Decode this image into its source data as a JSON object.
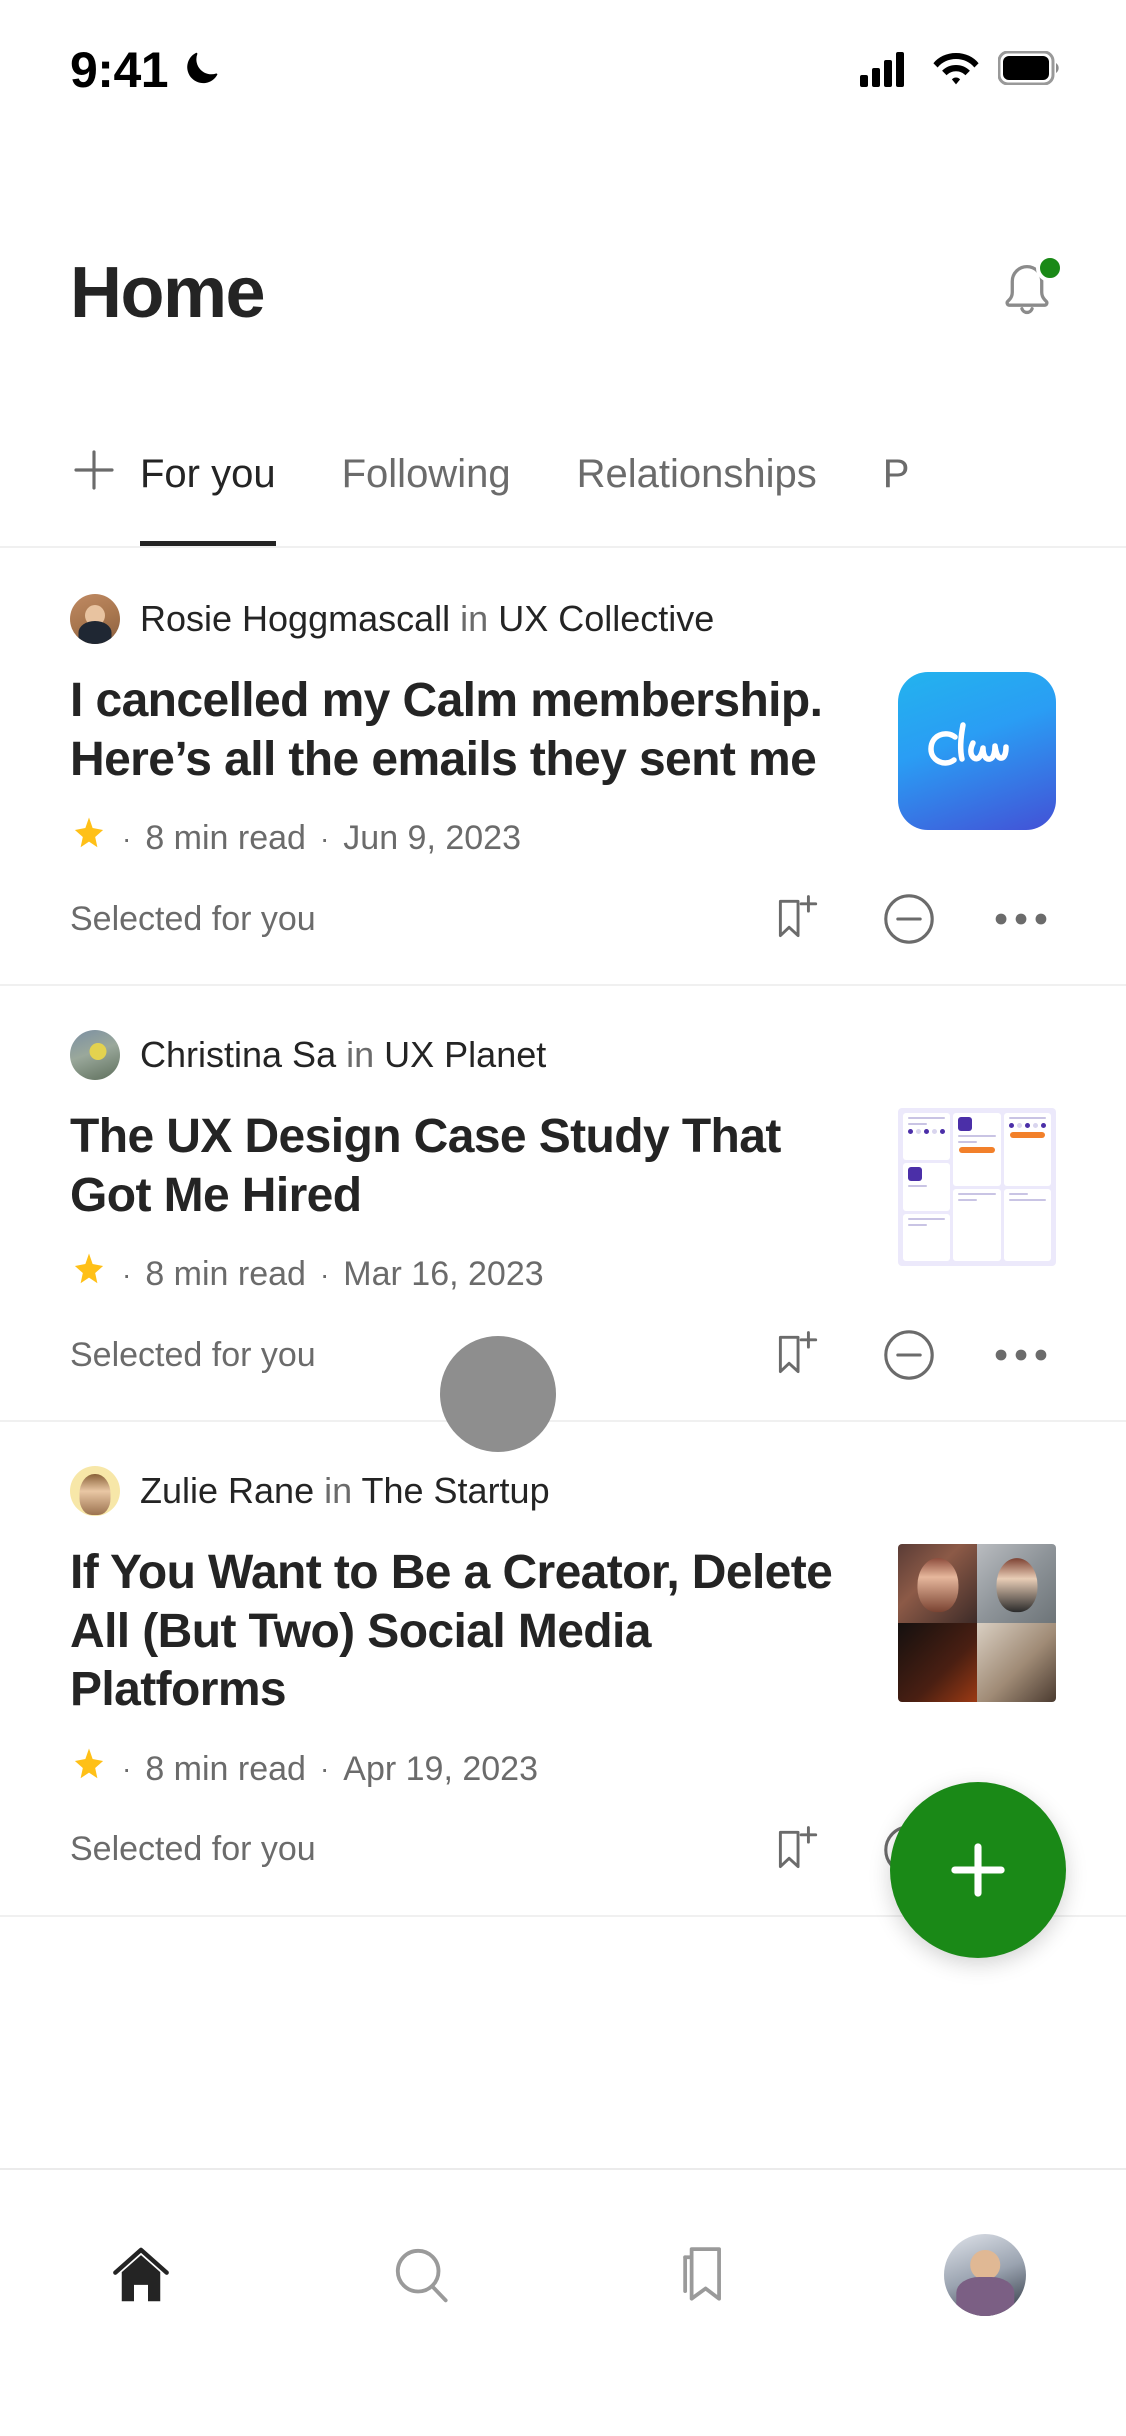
{
  "status_bar": {
    "time": "9:41",
    "dnd_icon": "moon-icon",
    "signal_icon": "cellular-signal-icon",
    "wifi_icon": "wifi-icon",
    "battery_icon": "battery-full-icon"
  },
  "header": {
    "title": "Home",
    "notifications_icon": "bell-icon",
    "has_unread_badge": true,
    "badge_color": "#1a8917"
  },
  "tabs": {
    "add_icon": "plus-icon",
    "items": [
      {
        "label": "For you",
        "active": true
      },
      {
        "label": "Following",
        "active": false
      },
      {
        "label": "Relationships",
        "active": false
      },
      {
        "label": "P",
        "active": false
      }
    ]
  },
  "feed": {
    "articles": [
      {
        "author": "Rosie Hoggmascall",
        "in_word": "in",
        "publication": "UX Collective",
        "title": "I cancelled my Calm membership. Here’s all the emails they sent me",
        "member_icon": "star-icon",
        "read_time": "8  min read",
        "date": "Jun 9, 2023",
        "reason": "Selected for you",
        "thumbnail": "calm-app-icon",
        "actions": [
          "bookmark-add-icon",
          "circle-minus-icon",
          "more-horizontal-icon"
        ]
      },
      {
        "author": "Christina Sa",
        "in_word": "in",
        "publication": "UX Planet",
        "title": "The UX Design Case Study That Got Me Hired",
        "member_icon": "star-icon",
        "read_time": "8  min read",
        "date": "Mar 16, 2023",
        "reason": "Selected for you",
        "thumbnail": "ux-case-study-mockup",
        "actions": [
          "bookmark-add-icon",
          "circle-minus-icon",
          "more-horizontal-icon"
        ]
      },
      {
        "author": "Zulie Rane",
        "in_word": "in",
        "publication": "The Startup",
        "title": "If You Want to Be a Creator, Delete All (But Two) Social Media Platforms",
        "member_icon": "star-icon",
        "read_time": "8  min read",
        "date": "Apr 19, 2023",
        "reason": "Selected for you",
        "thumbnail": "ai-portrait-grid",
        "actions": [
          "bookmark-add-icon",
          "circle-minus-icon",
          "more-horizontal-icon"
        ]
      }
    ]
  },
  "fab": {
    "icon": "plus-icon",
    "color": "#1a8917"
  },
  "bottom_nav": {
    "items": [
      {
        "name": "home",
        "icon": "home-icon",
        "active": true
      },
      {
        "name": "search",
        "icon": "search-icon",
        "active": false
      },
      {
        "name": "library",
        "icon": "bookmark-icon",
        "active": false
      },
      {
        "name": "profile",
        "icon": "avatar-icon",
        "active": false
      }
    ]
  },
  "colors": {
    "accent_green": "#1a8917",
    "text_primary": "#242424",
    "text_secondary": "#6b6b6b",
    "star_yellow": "#ffc017",
    "divider": "#f0f0f0"
  }
}
